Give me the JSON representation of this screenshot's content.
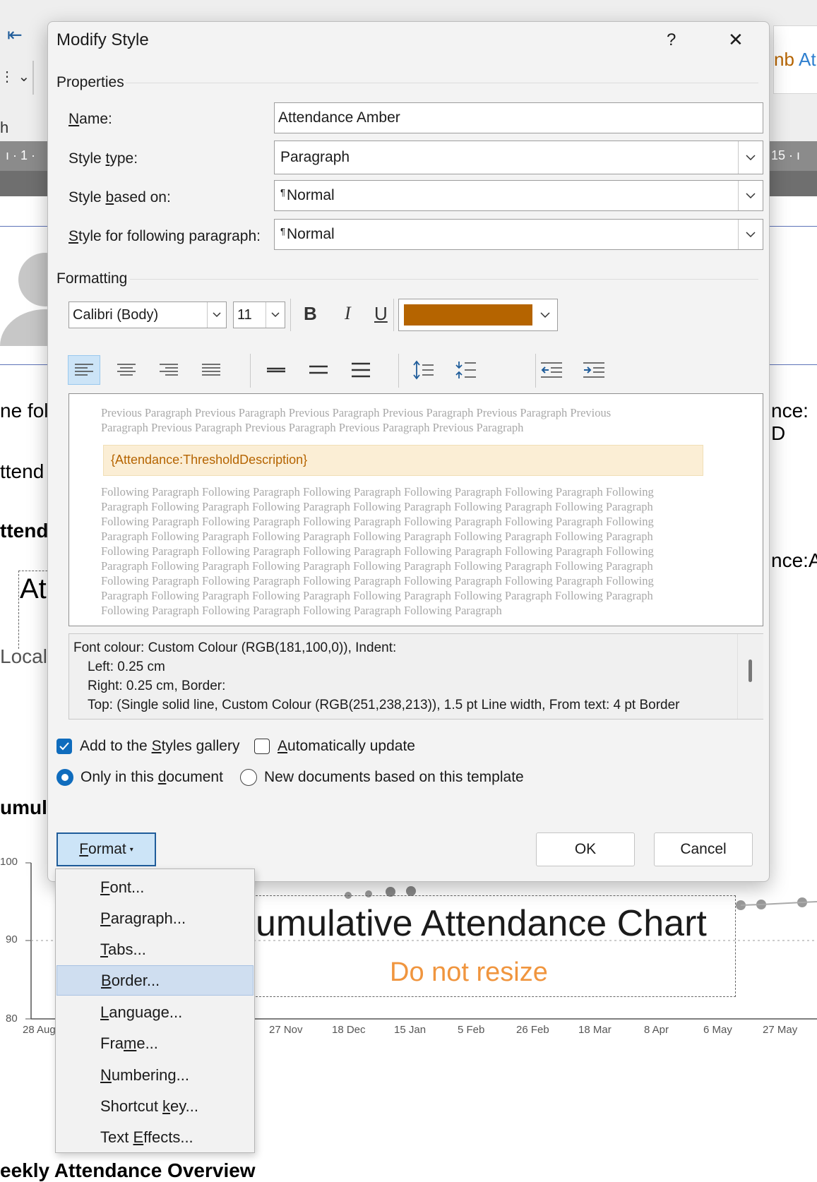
{
  "background_doc": {
    "ribbon_right_tab_1": "nb",
    "ribbon_right_tab_2": "At",
    "ribbon_left_char": "h",
    "ruler_left": "1",
    "ruler_right": "15",
    "left_texts": [
      "ne foll",
      "ttend",
      "ttend",
      "At",
      "Local",
      "umula"
    ],
    "right_texts": [
      "nce: D",
      "nce:Ab"
    ],
    "chart_title": "umulative Attendance Chart",
    "chart_subtitle": "Do not resize",
    "bottom_heading": "eekly Attendance Overview",
    "chart_data": {
      "type": "line",
      "yticks": [
        "100",
        "90",
        "80"
      ],
      "ylim": [
        80,
        100
      ],
      "xticks": [
        "28 Aug",
        "27 Nov",
        "18 Dec",
        "15 Jan",
        "5 Feb",
        "26 Feb",
        "18 Mar",
        "8 Apr",
        "6 May",
        "27 May"
      ]
    }
  },
  "dialog": {
    "title": "Modify Style",
    "help": "?",
    "close": "✕",
    "properties_label": "Properties",
    "name_label": "Name:",
    "name_value": "Attendance Amber",
    "style_type_label": "Style type:",
    "style_type_value": "Paragraph",
    "based_on_label": "Style based on:",
    "based_on_value": "Normal",
    "following_label": "Style for following paragraph:",
    "following_value": "Normal",
    "formatting_label": "Formatting",
    "font_value": "Calibri (Body)",
    "size_value": "11",
    "bold": "B",
    "italic": "I",
    "underline": "U",
    "font_color": "#b56400",
    "preview": {
      "previous": "Previous Paragraph Previous Paragraph Previous Paragraph Previous Paragraph Previous Paragraph Previous Paragraph Previous Paragraph Previous Paragraph Previous Paragraph Previous Paragraph",
      "sample": "{Attendance:ThresholdDescription}",
      "following": "Following Paragraph Following Paragraph Following Paragraph Following Paragraph Following Paragraph Following Paragraph Following Paragraph Following Paragraph Following Paragraph Following Paragraph Following Paragraph Following Paragraph Following Paragraph Following Paragraph Following Paragraph Following Paragraph Following Paragraph Following Paragraph Following Paragraph Following Paragraph Following Paragraph Following Paragraph Following Paragraph Following Paragraph Following Paragraph Following Paragraph Following Paragraph Following Paragraph Following Paragraph Following Paragraph Following Paragraph Following Paragraph Following Paragraph Following Paragraph Following Paragraph Following Paragraph Following Paragraph Following Paragraph Following Paragraph Following Paragraph Following Paragraph Following Paragraph Following Paragraph Following Paragraph Following Paragraph Following Paragraph Following Paragraph Following Paragraph"
    },
    "description_lines": [
      "Font colour: Custom Colour (RGB(181,100,0)), Indent:",
      "Left:  0.25 cm",
      "Right:  0.25 cm, Border:",
      "Top: (Single solid line, Custom Colour (RGB(251,238,213)),  1.5 pt Line width, From text:  4 pt Border"
    ],
    "add_gallery_label": "Add to the Styles gallery",
    "add_gallery_checked": true,
    "auto_update_label": "Automatically update",
    "auto_update_checked": false,
    "only_doc_label": "Only in this document",
    "new_docs_label": "New documents based on this template",
    "format_button": "Format",
    "ok_button": "OK",
    "cancel_button": "Cancel"
  },
  "format_menu": {
    "items": [
      "Font...",
      "Paragraph...",
      "Tabs...",
      "Border...",
      "Language...",
      "Frame...",
      "Numbering...",
      "Shortcut key...",
      "Text Effects..."
    ],
    "highlighted": "Border..."
  }
}
